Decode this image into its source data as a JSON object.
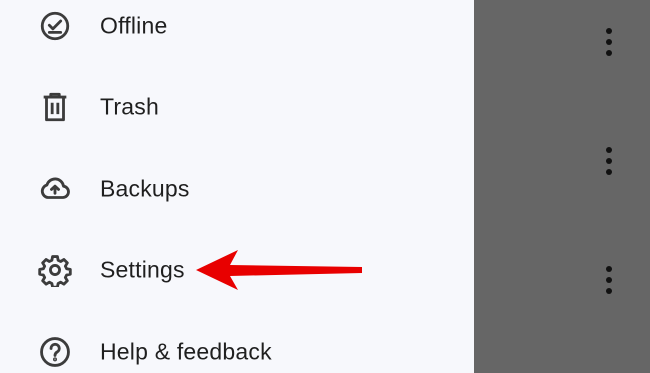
{
  "drawer": {
    "items": [
      {
        "label": "Offline",
        "icon": "offline-check-icon"
      },
      {
        "label": "Trash",
        "icon": "trash-icon"
      },
      {
        "label": "Backups",
        "icon": "cloud-upload-icon"
      },
      {
        "label": "Settings",
        "icon": "gear-icon"
      },
      {
        "label": "Help & feedback",
        "icon": "help-icon"
      }
    ]
  },
  "overlay": {
    "arrow_color": "#e80000",
    "arrow_target": "Settings"
  },
  "colors": {
    "drawer_bg": "#f7f8fc",
    "scrim": "#666666",
    "text": "#1f1f1f"
  },
  "scrim": {
    "more_buttons": [
      "more-vert-icon",
      "more-vert-icon",
      "more-vert-icon"
    ]
  }
}
